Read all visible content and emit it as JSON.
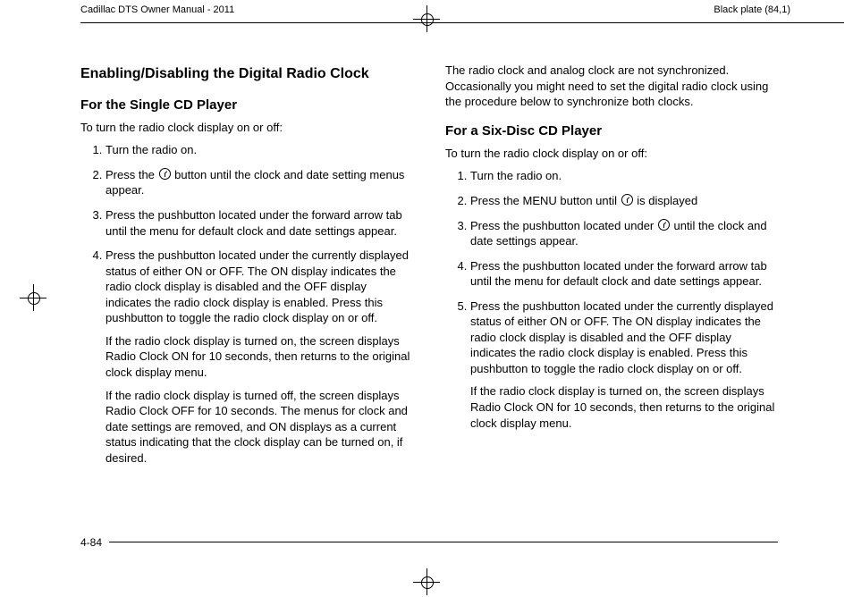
{
  "header": {
    "left": "Cadillac DTS Owner Manual - 2011",
    "right": "Black plate (84,1)"
  },
  "footer": {
    "page": "4-84"
  },
  "left_col": {
    "title": "Enabling/Disabling the Digital Radio Clock",
    "sub1": "For the Single CD Player",
    "intro": "To turn the radio clock display on or off:",
    "step1": "Turn the radio on.",
    "step2a": "Press the ",
    "step2b": " button until the clock and date setting menus appear.",
    "step3": "Press the pushbutton located under the forward arrow tab until the menu for default clock and date settings appear.",
    "step4": "Press the pushbutton located under the currently displayed status of either ON or OFF. The ON display indicates the radio clock display is disabled and the OFF display indicates the radio clock display is enabled. Press this pushbutton to toggle the radio clock display on or off.",
    "step4_sub1": "If the radio clock display is turned on, the screen displays Radio Clock ON for 10 seconds, then returns to the original clock display menu.",
    "step4_sub2": "If the radio clock display is turned off, the screen displays Radio Clock OFF for 10 seconds. The menus for clock and date settings are removed, and ON displays as a current status indicating that the clock display can be turned on, if desired."
  },
  "right_col": {
    "intro": "The radio clock and analog clock are not synchronized. Occasionally you might need to set the digital radio clock using the procedure below to synchronize both clocks.",
    "sub2": "For a Six-Disc CD Player",
    "intro2": "To turn the radio clock display on or off:",
    "r1": "Turn the radio on.",
    "r2a": "Press the MENU button until ",
    "r2b": " is displayed",
    "r3a": "Press the pushbutton located under ",
    "r3b": " until the clock and date settings appear.",
    "r4": "Press the pushbutton located under the forward arrow tab until the menu for default clock and date settings appear.",
    "r5": "Press the pushbutton located under the currently displayed status of either ON or OFF. The ON display indicates the radio clock display is disabled and the OFF display indicates the radio clock display is enabled. Press this pushbutton to toggle the radio clock display on or off.",
    "r5_sub": "If the radio clock display is turned on, the screen displays Radio Clock ON for 10 seconds, then returns to the original clock display menu."
  }
}
